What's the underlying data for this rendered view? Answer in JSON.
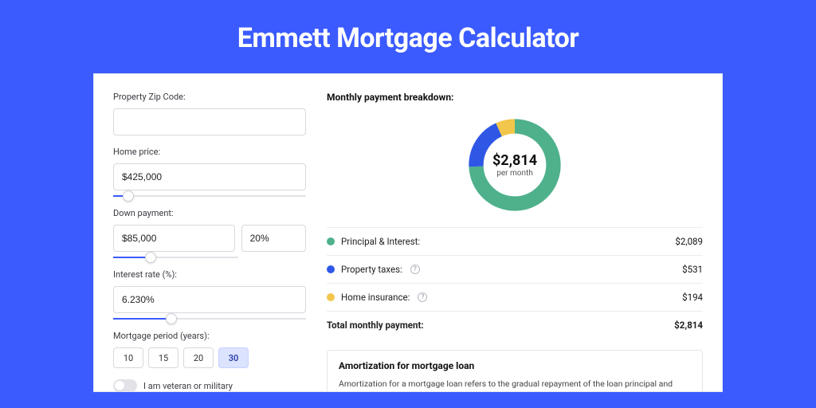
{
  "hero": {
    "title": "Emmett Mortgage Calculator"
  },
  "form": {
    "zip": {
      "label": "Property Zip Code:",
      "value": ""
    },
    "price": {
      "label": "Home price:",
      "value": "$425,000",
      "slider_pct": 8
    },
    "down": {
      "label": "Down payment:",
      "value": "$85,000",
      "pct_value": "20%",
      "slider_pct": 20
    },
    "rate": {
      "label": "Interest rate (%):",
      "value": "6.230%",
      "slider_pct": 30
    },
    "period": {
      "label": "Mortgage period (years):",
      "options": [
        "10",
        "15",
        "20",
        "30"
      ],
      "selected": "30"
    },
    "veteran": {
      "label": "I am veteran or military",
      "value": false
    }
  },
  "breakdown": {
    "title": "Monthly payment breakdown:",
    "amount": "$2,814",
    "sub": "per month",
    "items": [
      {
        "name": "Principal & Interest:",
        "amount": "$2,089",
        "color": "#4eb18c",
        "value": 2089,
        "info": false
      },
      {
        "name": "Property taxes:",
        "amount": "$531",
        "color": "#2f57e6",
        "value": 531,
        "info": true
      },
      {
        "name": "Home insurance:",
        "amount": "$194",
        "color": "#f2c64a",
        "value": 194,
        "info": true
      }
    ],
    "total_label": "Total monthly payment:",
    "total_amount": "$2,814"
  },
  "amort": {
    "title": "Amortization for mortgage loan",
    "body": "Amortization for a mortgage loan refers to the gradual repayment of the loan principal and interest over a specified"
  },
  "chart_data": {
    "type": "pie",
    "title": "Monthly payment breakdown",
    "categories": [
      "Principal & Interest",
      "Property taxes",
      "Home insurance"
    ],
    "values": [
      2089,
      531,
      194
    ],
    "colors": [
      "#4eb18c",
      "#2f57e6",
      "#f2c64a"
    ],
    "total": 2814,
    "unit": "USD per month"
  }
}
